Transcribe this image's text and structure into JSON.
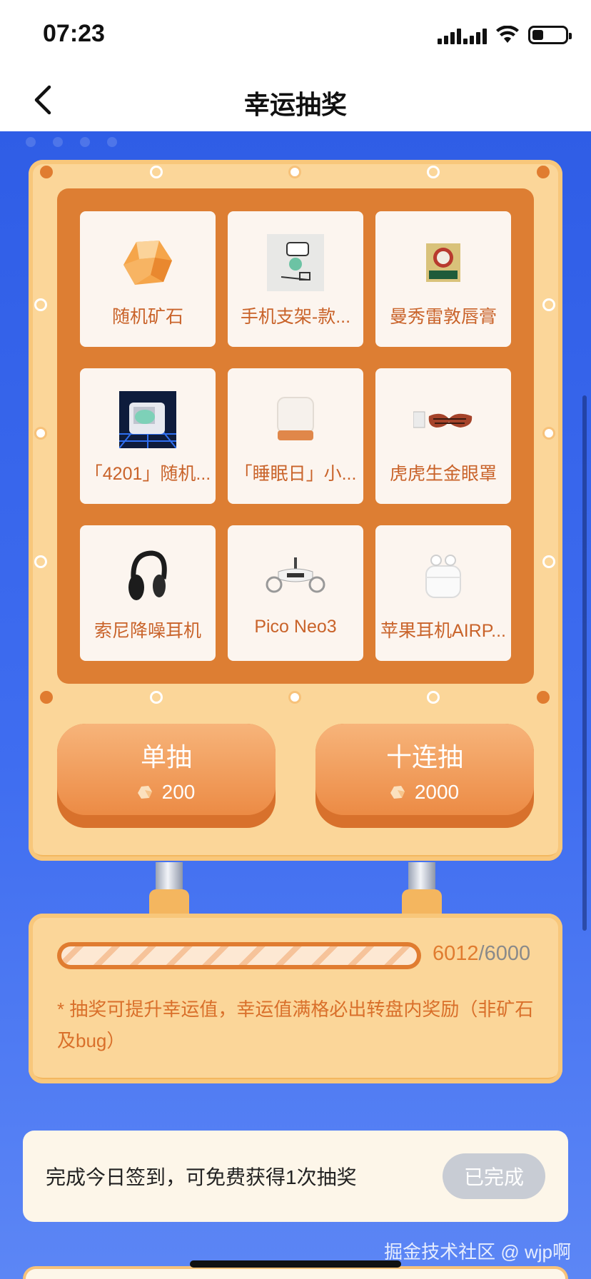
{
  "status_bar": {
    "time": "07:23",
    "battery_percent": 34
  },
  "nav": {
    "title": "幸运抽奖",
    "back_icon": "chevron-left-icon"
  },
  "prizes": [
    {
      "label": "随机矿石",
      "icon": "ore-icon"
    },
    {
      "label": "手机支架-款...",
      "icon": "phone-stand-icon"
    },
    {
      "label": "曼秀雷敦唇膏",
      "icon": "lip-balm-icon"
    },
    {
      "label": "「4201」随机...",
      "icon": "retro-computer-icon"
    },
    {
      "label": "「睡眠日」小...",
      "icon": "night-lamp-icon"
    },
    {
      "label": "虎虎生金眼罩",
      "icon": "eye-mask-icon"
    },
    {
      "label": "索尼降噪耳机",
      "icon": "headphones-icon"
    },
    {
      "label": "Pico Neo3",
      "icon": "vr-headset-icon"
    },
    {
      "label": "苹果耳机AIRP...",
      "icon": "airpods-icon"
    }
  ],
  "draw": {
    "single": {
      "label": "单抽",
      "cost": "200"
    },
    "ten": {
      "label": "十连抽",
      "cost": "2000"
    }
  },
  "luck": {
    "current": "6012",
    "separator": "/",
    "max": "6000",
    "fill_fraction": 1.0,
    "note": "* 抽奖可提升幸运值，幸运值满格必出转盘内奖励（非矿石及bug）"
  },
  "signin": {
    "text": "完成今日签到，可免费获得1次抽奖",
    "button": "已完成"
  },
  "watermark": "掘金技术社区 @ wjp啊",
  "colors": {
    "accent": "#e07c30",
    "board": "#fbd699",
    "background": "#3f6df0",
    "prize_text": "#c9632a"
  }
}
